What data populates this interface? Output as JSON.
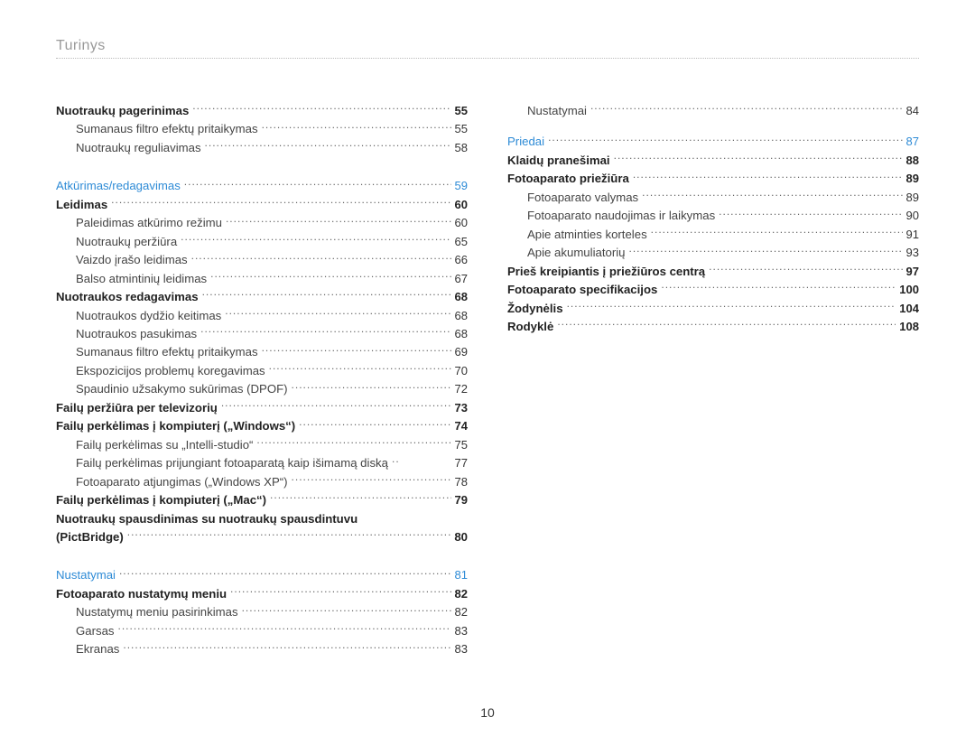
{
  "header": "Turinys",
  "page_number": "10",
  "col1": [
    {
      "label": "Nuotraukų pagerinimas",
      "page": "55",
      "bold": true
    },
    {
      "label": "Sumanaus filtro efektų pritaikymas",
      "page": "55",
      "sub": true
    },
    {
      "label": "Nuotraukų reguliavimas",
      "page": "58",
      "sub": true
    },
    {
      "spacer": true
    },
    {
      "label": "Atkūrimas/redagavimas",
      "page": "59",
      "section": true
    },
    {
      "label": "Leidimas",
      "page": "60",
      "bold": true
    },
    {
      "label": "Paleidimas atkūrimo režimu",
      "page": "60",
      "sub": true
    },
    {
      "label": "Nuotraukų peržiūra",
      "page": "65",
      "sub": true
    },
    {
      "label": "Vaizdo įrašo leidimas",
      "page": "66",
      "sub": true
    },
    {
      "label": "Balso atmintinių leidimas",
      "page": "67",
      "sub": true
    },
    {
      "label": "Nuotraukos redagavimas",
      "page": "68",
      "bold": true
    },
    {
      "label": "Nuotraukos dydžio keitimas",
      "page": "68",
      "sub": true
    },
    {
      "label": "Nuotraukos pasukimas",
      "page": "68",
      "sub": true
    },
    {
      "label": "Sumanaus filtro efektų pritaikymas",
      "page": "69",
      "sub": true
    },
    {
      "label": "Ekspozicijos problemų koregavimas",
      "page": "70",
      "sub": true
    },
    {
      "label": "Spaudinio užsakymo sukūrimas (DPOF)",
      "page": "72",
      "sub": true
    },
    {
      "label": "Failų peržiūra per televizorių",
      "page": "73",
      "bold": true
    },
    {
      "label": "Failų perkėlimas į kompiuterį („Windows“)",
      "page": "74",
      "bold": true
    },
    {
      "label": "Failų perkėlimas su „Intelli-studio“",
      "page": "75",
      "sub": true
    },
    {
      "label": "Failų perkėlimas prijungiant fotoaparatą kaip išimamą diską",
      "page": "77",
      "sub": true,
      "nodots": true
    },
    {
      "label": "Fotoaparato atjungimas („Windows XP“)",
      "page": "78",
      "sub": true
    },
    {
      "label": "Failų perkėlimas į kompiuterį („Mac“)",
      "page": "79",
      "bold": true
    },
    {
      "multiline1": "Nuotraukų spausdinimas su nuotraukų spausdintuvu",
      "multiline2": "(PictBridge)",
      "page": "80"
    },
    {
      "spacer": true
    },
    {
      "label": "Nustatymai",
      "page": "81",
      "section": true
    },
    {
      "label": "Fotoaparato nustatymų meniu",
      "page": "82",
      "bold": true
    },
    {
      "label": "Nustatymų meniu pasirinkimas",
      "page": "82",
      "sub": true
    },
    {
      "label": "Garsas",
      "page": "83",
      "sub": true
    },
    {
      "label": "Ekranas",
      "page": "83",
      "sub": true
    }
  ],
  "col2": [
    {
      "label": "Nustatymai",
      "page": "84",
      "sub": true
    },
    {
      "spacer_sm": true
    },
    {
      "label": "Priedai",
      "page": "87",
      "section": true
    },
    {
      "label": "Klaidų pranešimai",
      "page": "88",
      "bold": true
    },
    {
      "label": "Fotoaparato priežiūra",
      "page": "89",
      "bold": true
    },
    {
      "label": "Fotoaparato valymas",
      "page": "89",
      "sub": true
    },
    {
      "label": "Fotoaparato naudojimas ir laikymas",
      "page": "90",
      "sub": true
    },
    {
      "label": "Apie atminties korteles",
      "page": "91",
      "sub": true
    },
    {
      "label": "Apie akumuliatorių",
      "page": "93",
      "sub": true
    },
    {
      "label": "Prieš kreipiantis į priežiūros centrą",
      "page": "97",
      "bold": true
    },
    {
      "label": "Fotoaparato specifikacijos",
      "page": "100",
      "bold": true
    },
    {
      "label": "Žodynėlis",
      "page": "104",
      "bold": true
    },
    {
      "label": "Rodyklė",
      "page": "108",
      "bold": true
    }
  ]
}
